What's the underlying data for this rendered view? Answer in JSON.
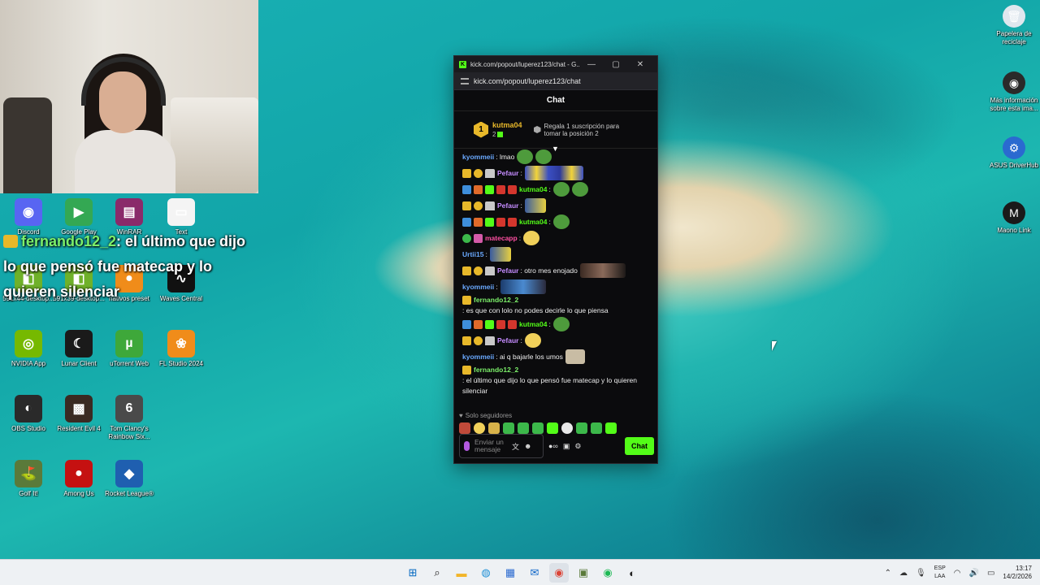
{
  "overlay": {
    "username": "fernando12_2",
    "message": ": el último que dijo lo que pensó fue matecap y lo quieren silenciar"
  },
  "desktop_left": [
    {
      "label": "Discord",
      "icon": "discord-icon",
      "color": "#5865f2",
      "glyph": "◉"
    },
    {
      "label": "Google Play",
      "icon": "google-play-icon",
      "color": "#34a853",
      "glyph": "▶"
    },
    {
      "label": "WinRAR",
      "icon": "winrar-icon",
      "color": "#8a2a6a",
      "glyph": "▤"
    },
    {
      "label": "Text",
      "icon": "document-icon",
      "color": "#f4f4f4",
      "glyph": "▭"
    },
    {
      "label": "591x44-desktop...",
      "icon": "nvidia-shortcut-icon",
      "color": "#6fb12a",
      "glyph": "◧"
    },
    {
      "label": "591x39-desktop...",
      "icon": "nvidia-shortcut-icon",
      "color": "#6fb12a",
      "glyph": "◧"
    },
    {
      "label": "nativos preset",
      "icon": "fl-preset-icon",
      "color": "#f08c1a",
      "glyph": "●"
    },
    {
      "label": "Waves Central",
      "icon": "waves-icon",
      "color": "#111111",
      "glyph": "∿"
    },
    {
      "label": "NVIDIA App",
      "icon": "nvidia-icon",
      "color": "#76b900",
      "glyph": "◎"
    },
    {
      "label": "Lunar Client",
      "icon": "lunar-client-icon",
      "color": "#1a1a1a",
      "glyph": "☾"
    },
    {
      "label": "uTorrent Web",
      "icon": "utorrent-icon",
      "color": "#3ea83a",
      "glyph": "µ"
    },
    {
      "label": "FL Studio 2024",
      "icon": "fl-studio-icon",
      "color": "#f08c1a",
      "glyph": "❀"
    },
    {
      "label": "OBS Studio",
      "icon": "obs-icon",
      "color": "#2a2a2a",
      "glyph": "◐"
    },
    {
      "label": "Resident Evil 4",
      "icon": "re4-icon",
      "color": "#3a2a22",
      "glyph": "▩"
    },
    {
      "label": "Tom Clancy's Rainbow Six...",
      "icon": "r6-icon",
      "color": "#4a4a4a",
      "glyph": "6"
    },
    {
      "label": "Golf It!",
      "icon": "golf-it-icon",
      "color": "#5a7a3a",
      "glyph": "⛳"
    },
    {
      "label": "Among Us",
      "icon": "among-us-icon",
      "color": "#c51111",
      "glyph": "●"
    },
    {
      "label": "Rocket League®",
      "icon": "rocket-league-icon",
      "color": "#1f5fb0",
      "glyph": "◆"
    }
  ],
  "desktop_right": [
    {
      "label": "Papelera de reciclaje",
      "icon": "recycle-bin-icon",
      "color": "#dfe7ee",
      "glyph": "🗑"
    },
    {
      "label": "Más información sobre esta ima...",
      "icon": "info-icon",
      "color": "#2a2a2a",
      "glyph": "◉"
    },
    {
      "label": "ASUS DriverHub",
      "icon": "asus-icon",
      "color": "#2a6ad0",
      "glyph": "⚙"
    },
    {
      "label": "Maono Link",
      "icon": "maono-icon",
      "color": "#1a1a1a",
      "glyph": "M"
    }
  ],
  "window": {
    "title": "kick.com/popout/luperez123/chat - G...",
    "minimize": "—",
    "maximize": "▢",
    "close": "✕",
    "address": "kick.com/popout/luperez123/chat",
    "header": "Chat",
    "leader": {
      "rank": "1",
      "username": "kutma04",
      "subs": "2",
      "gift_text": "Regala 1 suscripción para tomar la posición 2"
    },
    "messages": [
      {
        "user": "kyommeii",
        "color": "#6aa9ff",
        "badges": [],
        "text": ": lmao",
        "emotes": [
          "em-frog",
          "em-frog"
        ]
      },
      {
        "user": "Pefaur",
        "color": "#c58cff",
        "badges": [
          "b-crown",
          "b-one",
          "b-hat"
        ],
        "text": ":",
        "emotes": [
          "em-strip"
        ]
      },
      {
        "user": "kutma04",
        "color": "#53fc18",
        "badges": [
          "b-blue",
          "b-orange",
          "b-green",
          "b-red",
          "b-red"
        ],
        "text": ":",
        "emotes": [
          "em-frog",
          "em-frog"
        ]
      },
      {
        "user": "Pefaur",
        "color": "#c58cff",
        "badges": [
          "b-crown",
          "b-one",
          "b-hat"
        ],
        "text": ":",
        "emotes": [
          "em-small"
        ]
      },
      {
        "user": "kutma04",
        "color": "#53fc18",
        "badges": [
          "b-blue",
          "b-orange",
          "b-green",
          "b-red",
          "b-red"
        ],
        "text": ":",
        "emotes": [
          "em-frog"
        ]
      },
      {
        "user": "matecapp",
        "color": "#ff4fa1",
        "badges": [
          "b-gem",
          "b-pink"
        ],
        "text": ":",
        "emotes": [
          "em-face"
        ]
      },
      {
        "user": "Urtii15",
        "color": "#6aa9ff",
        "badges": [],
        "text": ":",
        "emotes": [
          "em-small"
        ]
      },
      {
        "user": "Pefaur",
        "color": "#c58cff",
        "badges": [
          "b-crown",
          "b-one",
          "b-hat"
        ],
        "text": ": otro mes enojado",
        "emotes": [
          "em-photo"
        ]
      },
      {
        "user": "kyommeii",
        "color": "#6aa9ff",
        "badges": [],
        "text": ":",
        "emotes": [
          "em-cars"
        ]
      },
      {
        "user": "fernando12_2",
        "color": "#7cf06a",
        "badges": [
          "b-crown"
        ],
        "text": ": es que con lolo no podes decirle lo que piensa",
        "emotes": []
      },
      {
        "user": "kutma04",
        "color": "#53fc18",
        "badges": [
          "b-blue",
          "b-orange",
          "b-green",
          "b-red",
          "b-red"
        ],
        "text": ":",
        "emotes": [
          "em-frog"
        ]
      },
      {
        "user": "Pefaur",
        "color": "#c58cff",
        "badges": [
          "b-crown",
          "b-one",
          "b-hat"
        ],
        "text": ":",
        "emotes": [
          "em-face"
        ]
      },
      {
        "user": "kyommeii",
        "color": "#6aa9ff",
        "badges": [],
        "text": ": ai q bajarle los umos",
        "emotes": [
          "em-brown"
        ]
      },
      {
        "user": "fernando12_2",
        "color": "#7cf06a",
        "badges": [
          "b-crown"
        ],
        "text": ": el último que dijo lo que pensó fue matecap y lo quieren silenciar",
        "emotes": []
      }
    ],
    "followers_only": "Solo seguidores",
    "input_placeholder": "Enviar un mensaje",
    "chat_button": "Chat"
  },
  "taskbar": {
    "apps": [
      {
        "icon": "windows-start-icon",
        "glyph": "⊞",
        "color": "#0067c0"
      },
      {
        "icon": "search-icon",
        "glyph": "⌕",
        "color": "#222222"
      },
      {
        "icon": "file-explorer-icon",
        "glyph": "▬",
        "color": "#f2b52a"
      },
      {
        "icon": "edge-icon",
        "glyph": "◍",
        "color": "#1e8fd6"
      },
      {
        "icon": "store-icon",
        "glyph": "▦",
        "color": "#2a6ad0"
      },
      {
        "icon": "outlook-icon",
        "glyph": "✉",
        "color": "#0a64c8"
      },
      {
        "icon": "chrome-icon",
        "glyph": "◉",
        "color": "#db4437"
      },
      {
        "icon": "minecraft-icon",
        "glyph": "▣",
        "color": "#5a7a3a"
      },
      {
        "icon": "spotify-icon",
        "glyph": "◉",
        "color": "#1db954"
      },
      {
        "icon": "obs-taskbar-icon",
        "glyph": "◐",
        "color": "#222222"
      }
    ],
    "lang_top": "ESP",
    "lang_bottom": "LAA",
    "time": "13:17",
    "date": "14/2/2026"
  }
}
